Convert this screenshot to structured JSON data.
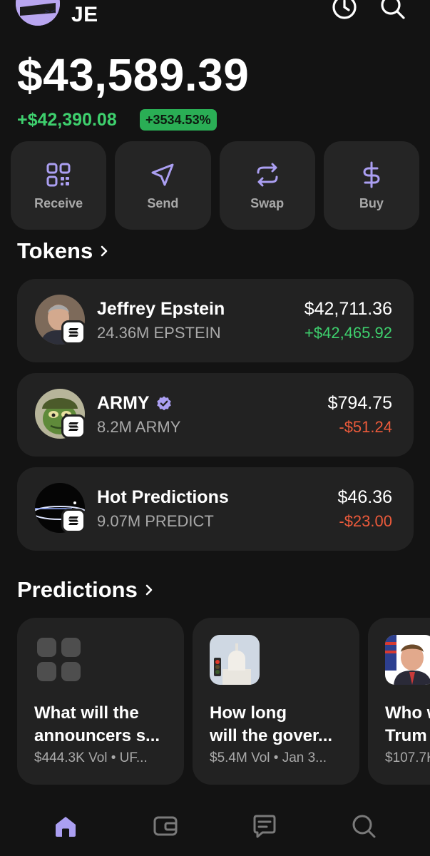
{
  "header": {
    "account_name": "JE",
    "icons": [
      "avatar-icon",
      "history-icon",
      "search-icon"
    ]
  },
  "portfolio": {
    "balance": "$43,589.39",
    "change_abs": "+$42,390.08",
    "change_pct": "+3534.53%"
  },
  "actions": [
    {
      "label": "Receive",
      "icon": "qr-code-icon"
    },
    {
      "label": "Send",
      "icon": "send-icon"
    },
    {
      "label": "Swap",
      "icon": "swap-icon"
    },
    {
      "label": "Buy",
      "icon": "dollar-icon"
    }
  ],
  "tokens": {
    "title": "Tokens",
    "items": [
      {
        "name": "Jeffrey Epstein",
        "amount": "24.36M EPSTEIN",
        "value": "$42,711.36",
        "change": "+$42,465.92",
        "verified": false
      },
      {
        "name": "ARMY",
        "amount": "8.2M ARMY",
        "value": "$794.75",
        "change": "-$51.24",
        "verified": true
      },
      {
        "name": "Hot Predictions",
        "amount": "9.07M PREDICT",
        "value": "$46.36",
        "change": "-$23.00",
        "verified": false
      }
    ]
  },
  "predictions": {
    "title": "Predictions",
    "items": [
      {
        "title": "What will the\nannouncers s...",
        "meta": "$444.3K Vol • UF..."
      },
      {
        "title": "How long\nwill the gover...",
        "meta": "$5.4M Vol • Jan 3..."
      },
      {
        "title": "Who w\nTrum",
        "meta": "$107.7K"
      }
    ]
  },
  "nav": [
    {
      "name": "home",
      "icon": "home-icon",
      "active": true
    },
    {
      "name": "wallet",
      "icon": "wallet-icon",
      "active": false
    },
    {
      "name": "messages",
      "icon": "chat-icon",
      "active": false
    },
    {
      "name": "search",
      "icon": "search-icon",
      "active": false
    }
  ],
  "colors": {
    "background": "#131313",
    "card": "#222222",
    "accent": "#ab9ff2",
    "positive": "#3ecf6d",
    "negative": "#ec5a3b"
  }
}
